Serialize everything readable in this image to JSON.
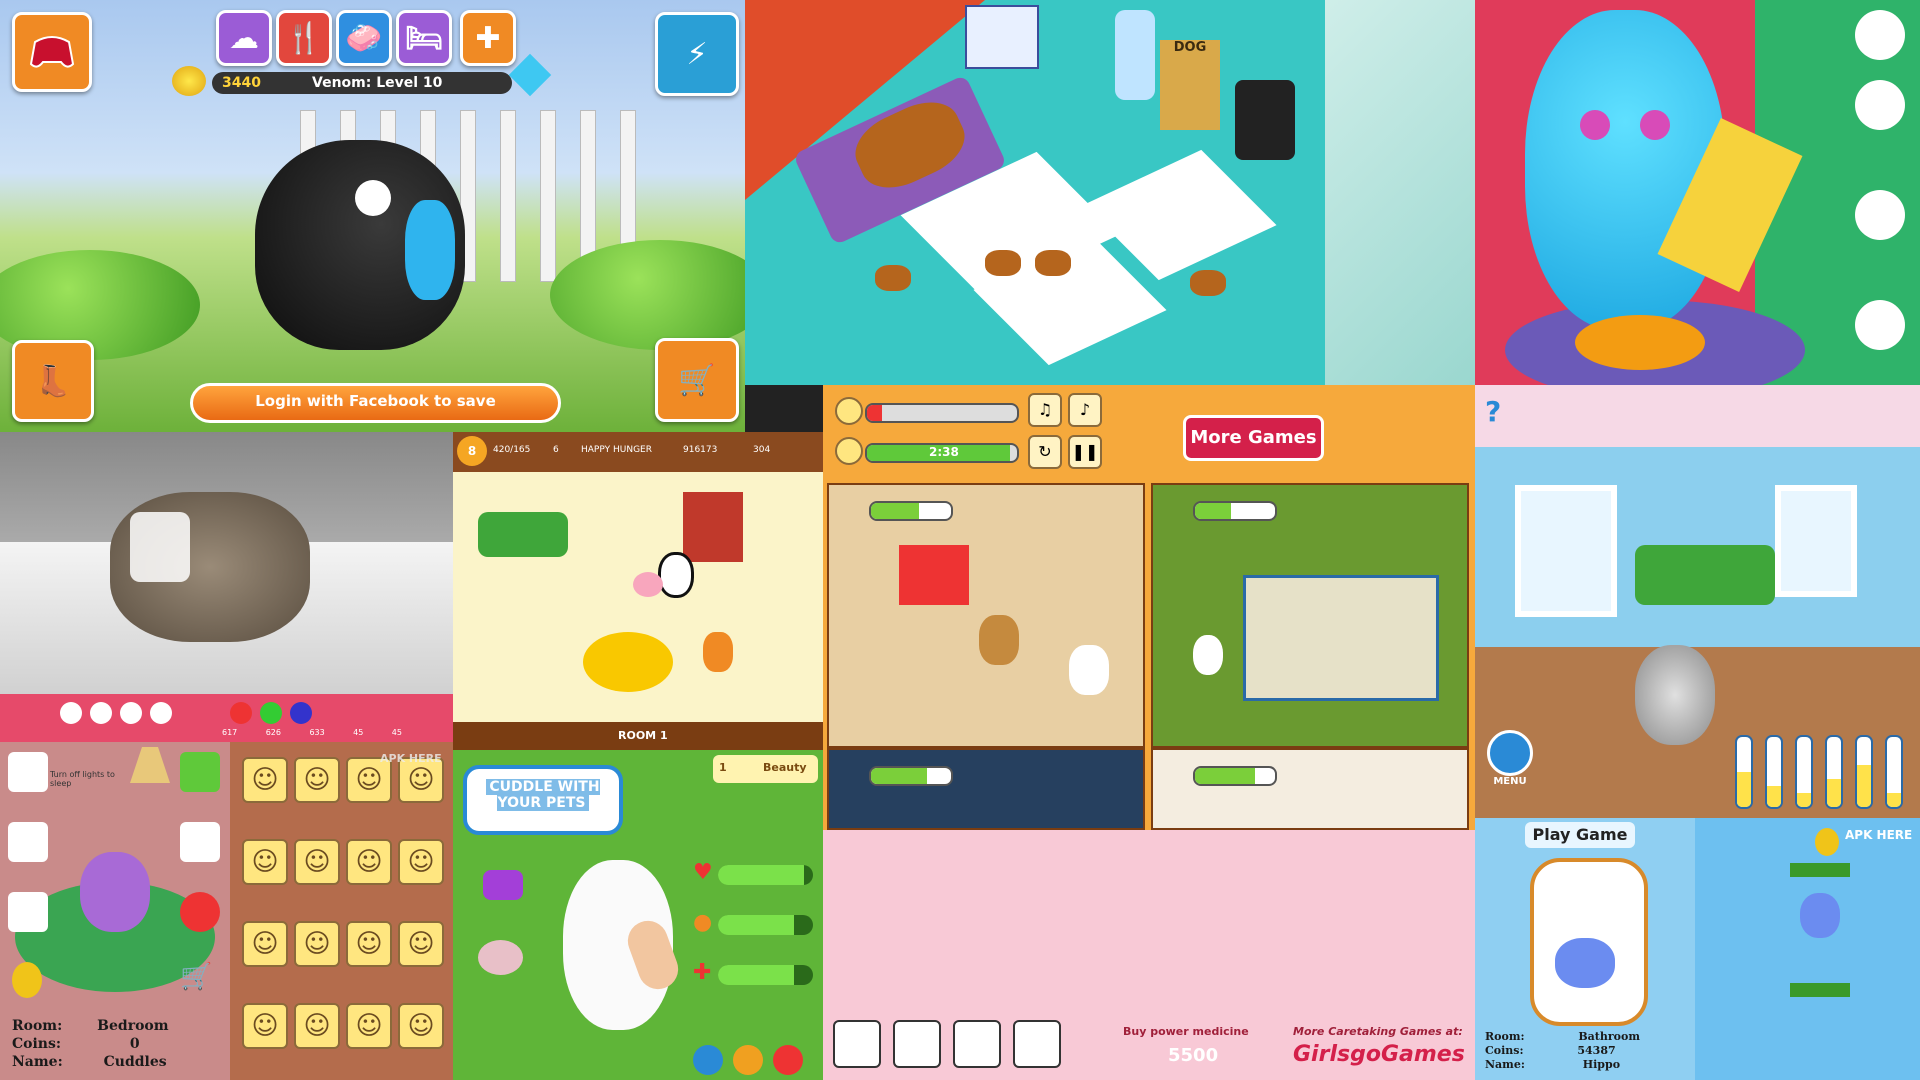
{
  "tile1": {
    "coins": "3440",
    "status": "Venom: Level 10",
    "login_label": "Login with Facebook to save",
    "icons": [
      "brain-icon",
      "fork-knife-icon",
      "soap-icon",
      "bed-icon",
      "medical-cross-icon"
    ],
    "colors": {
      "icon_bg": "#9b5cd6",
      "accent": "#f08a24"
    }
  },
  "tile2": {
    "food_bag_label": "DOG"
  },
  "tile5": {
    "level": "8",
    "stats": [
      "420/165",
      "6",
      "HAPPY",
      "HUNGER",
      "916173",
      "304"
    ],
    "room_label": "ROOM 1"
  },
  "tile6": {
    "timer": "2:38",
    "timer_progress": 0.95,
    "mood_progress": 0.1,
    "more_games_label": "More Games"
  },
  "tile4": {
    "counters": [
      "617",
      "626",
      "633",
      "45",
      "45"
    ]
  },
  "tile7": {
    "help_label": "?",
    "menu_label": "MENU",
    "meters": [
      0.5,
      0.3,
      0.2,
      0.4,
      0.6,
      0.2
    ]
  },
  "tile8": {
    "hint": "Turn off lights to sleep",
    "room_label": "Room:",
    "room_value": "Bedroom",
    "coins_label": "Coins:",
    "coins_value": "0",
    "name_label": "Name:",
    "name_value": "Cuddles"
  },
  "tile9": {
    "watermark": "APK HERE",
    "smiley_count": 16
  },
  "tile10": {
    "speech": "CUDDLE WITH YOUR PETS",
    "badge_level": "1",
    "badge_label": "Beauty",
    "stats": [
      0.9,
      0.8,
      0.8
    ]
  },
  "tile11": {
    "buy_label": "Buy power medicine",
    "price": "5500",
    "promo": "More Caretaking Games at:",
    "brand": "GirlsgoGames"
  },
  "tile12": {
    "play_label": "Play Game",
    "room_label": "Room:",
    "room_value": "Bathroom",
    "coins_label": "Coins:",
    "coins_value": "54387",
    "name_label": "Name:",
    "name_value": "Hippo",
    "watermark": "APK HERE"
  }
}
